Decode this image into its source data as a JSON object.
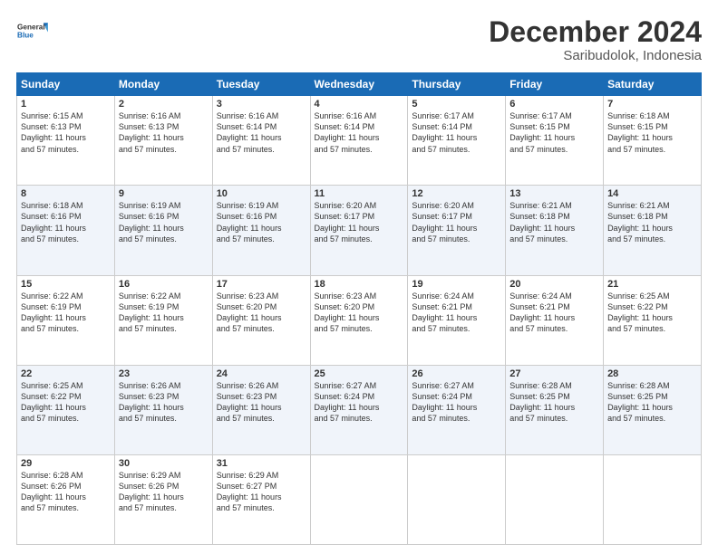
{
  "logo": {
    "line1": "General",
    "line2": "Blue"
  },
  "header": {
    "month": "December 2024",
    "location": "Saribudolok, Indonesia"
  },
  "weekdays": [
    "Sunday",
    "Monday",
    "Tuesday",
    "Wednesday",
    "Thursday",
    "Friday",
    "Saturday"
  ],
  "weeks": [
    [
      {
        "day": "1",
        "sunrise": "6:15 AM",
        "sunset": "6:13 PM"
      },
      {
        "day": "2",
        "sunrise": "6:16 AM",
        "sunset": "6:13 PM"
      },
      {
        "day": "3",
        "sunrise": "6:16 AM",
        "sunset": "6:14 PM"
      },
      {
        "day": "4",
        "sunrise": "6:16 AM",
        "sunset": "6:14 PM"
      },
      {
        "day": "5",
        "sunrise": "6:17 AM",
        "sunset": "6:14 PM"
      },
      {
        "day": "6",
        "sunrise": "6:17 AM",
        "sunset": "6:15 PM"
      },
      {
        "day": "7",
        "sunrise": "6:18 AM",
        "sunset": "6:15 PM"
      }
    ],
    [
      {
        "day": "8",
        "sunrise": "6:18 AM",
        "sunset": "6:16 PM"
      },
      {
        "day": "9",
        "sunrise": "6:19 AM",
        "sunset": "6:16 PM"
      },
      {
        "day": "10",
        "sunrise": "6:19 AM",
        "sunset": "6:16 PM"
      },
      {
        "day": "11",
        "sunrise": "6:20 AM",
        "sunset": "6:17 PM"
      },
      {
        "day": "12",
        "sunrise": "6:20 AM",
        "sunset": "6:17 PM"
      },
      {
        "day": "13",
        "sunrise": "6:21 AM",
        "sunset": "6:18 PM"
      },
      {
        "day": "14",
        "sunrise": "6:21 AM",
        "sunset": "6:18 PM"
      }
    ],
    [
      {
        "day": "15",
        "sunrise": "6:22 AM",
        "sunset": "6:19 PM"
      },
      {
        "day": "16",
        "sunrise": "6:22 AM",
        "sunset": "6:19 PM"
      },
      {
        "day": "17",
        "sunrise": "6:23 AM",
        "sunset": "6:20 PM"
      },
      {
        "day": "18",
        "sunrise": "6:23 AM",
        "sunset": "6:20 PM"
      },
      {
        "day": "19",
        "sunrise": "6:24 AM",
        "sunset": "6:21 PM"
      },
      {
        "day": "20",
        "sunrise": "6:24 AM",
        "sunset": "6:21 PM"
      },
      {
        "day": "21",
        "sunrise": "6:25 AM",
        "sunset": "6:22 PM"
      }
    ],
    [
      {
        "day": "22",
        "sunrise": "6:25 AM",
        "sunset": "6:22 PM"
      },
      {
        "day": "23",
        "sunrise": "6:26 AM",
        "sunset": "6:23 PM"
      },
      {
        "day": "24",
        "sunrise": "6:26 AM",
        "sunset": "6:23 PM"
      },
      {
        "day": "25",
        "sunrise": "6:27 AM",
        "sunset": "6:24 PM"
      },
      {
        "day": "26",
        "sunrise": "6:27 AM",
        "sunset": "6:24 PM"
      },
      {
        "day": "27",
        "sunrise": "6:28 AM",
        "sunset": "6:25 PM"
      },
      {
        "day": "28",
        "sunrise": "6:28 AM",
        "sunset": "6:25 PM"
      }
    ],
    [
      {
        "day": "29",
        "sunrise": "6:28 AM",
        "sunset": "6:26 PM"
      },
      {
        "day": "30",
        "sunrise": "6:29 AM",
        "sunset": "6:26 PM"
      },
      {
        "day": "31",
        "sunrise": "6:29 AM",
        "sunset": "6:27 PM"
      },
      null,
      null,
      null,
      null
    ]
  ],
  "daylight": "Daylight: 11 hours and 57 minutes."
}
